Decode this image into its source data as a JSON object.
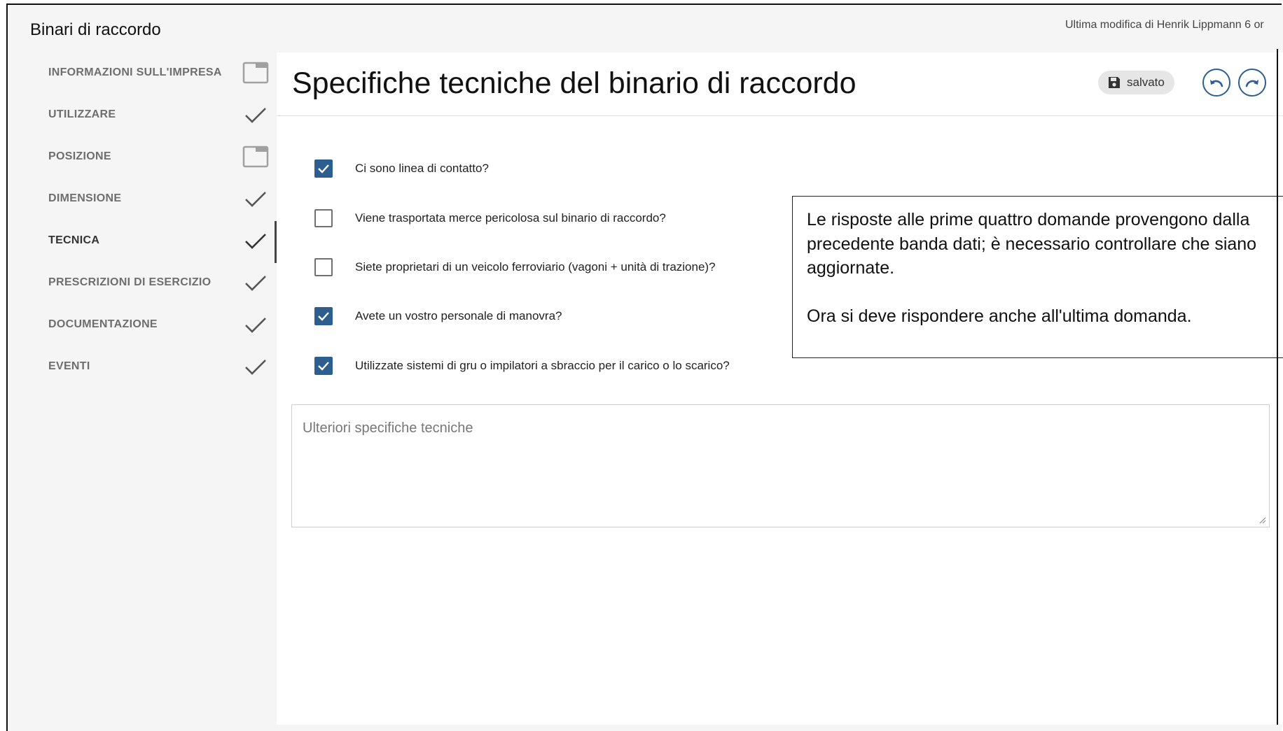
{
  "header": {
    "title": "Binari di raccordo",
    "last_modified": "Ultima modifica di Henrik Lippmann 6 or"
  },
  "sidebar": {
    "items": [
      {
        "label": "INFORMAZIONI SULL'IMPRESA",
        "status": "window-icon"
      },
      {
        "label": "UTILIZZARE",
        "status": "check-icon"
      },
      {
        "label": "POSIZIONE",
        "status": "window-icon"
      },
      {
        "label": "DIMENSIONE",
        "status": "check-icon"
      },
      {
        "label": "TECNICA",
        "status": "check-icon",
        "active": true
      },
      {
        "label": "PRESCRIZIONI DI ESERCIZIO",
        "status": "check-icon"
      },
      {
        "label": "DOCUMENTAZIONE",
        "status": "check-icon"
      },
      {
        "label": "EVENTI",
        "status": "check-icon"
      }
    ]
  },
  "main": {
    "title": "Specifiche tecniche del binario di raccordo",
    "saved_label": "salvato",
    "undo_icon": "undo-icon",
    "redo_icon": "redo-icon",
    "questions": [
      {
        "text": "Ci sono linea di contatto?",
        "checked": true
      },
      {
        "text": "Viene trasportata merce pericolosa sul binario di raccordo?",
        "checked": false
      },
      {
        "text": "Siete proprietari di un veicolo ferroviario (vagoni + unità di trazione)?",
        "checked": false
      },
      {
        "text": "Avete un vostro personale di manovra?",
        "checked": true
      },
      {
        "text": "Utilizzate sistemi di gru o impilatori a sbraccio per il carico o lo scarico?",
        "checked": true
      }
    ],
    "textarea": {
      "placeholder": "Ulteriori specifiche tecniche",
      "value": ""
    }
  },
  "note": {
    "paragraph1": "Le risposte alle prime quattro domande provengono dalla precedente banda dati; è necessario controllare che siano aggiornate.",
    "paragraph2": "Ora si deve rispondere anche all'ultima domanda."
  },
  "colors": {
    "accent": "#2c5f8f",
    "sidebar_bg": "#f5f5f5",
    "icon_gray": "#6e6e6e"
  }
}
